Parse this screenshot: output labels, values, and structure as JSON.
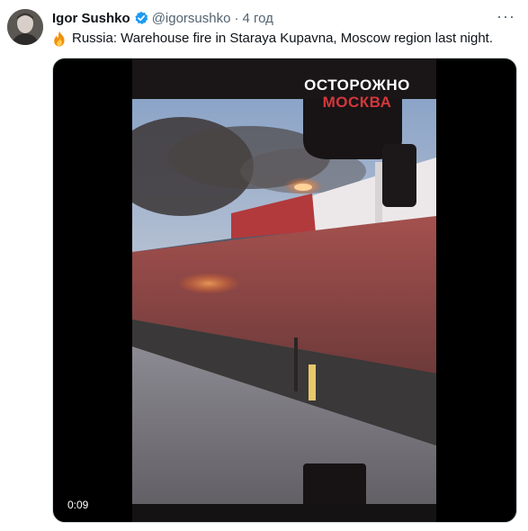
{
  "author": {
    "name": "Igor Sushko",
    "handle": "@igorsushko",
    "separator": "·",
    "time": "4 год",
    "verified_icon": "verified-badge-icon"
  },
  "tweet": {
    "emoji_icon": "fire-emoji-icon",
    "text": "Russia: Warehouse fire in Staraya Kupavna, Moscow region last night."
  },
  "menu": {
    "more_label": "···"
  },
  "media": {
    "watermark_line1": "ОСТОРОЖНО",
    "watermark_line2": "МОСКВА",
    "timestamp": "0:09"
  },
  "colors": {
    "verified": "#1d9bf0",
    "watermark_accent": "#d4373b",
    "secondary_text": "#536471"
  }
}
